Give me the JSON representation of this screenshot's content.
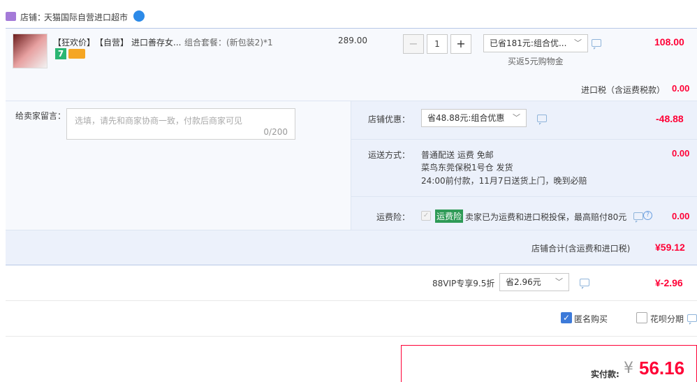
{
  "shop": {
    "label": "店铺：",
    "name": "天猫国际自营进口超市",
    "wangwang_icon": "wangwang-chat-icon"
  },
  "item": {
    "tag1": "【狂欢价】",
    "tag2": "【自营】",
    "title": "进口善存女...",
    "combo": "组合套餐：(新包装2)*1",
    "unit_price": "289.00",
    "quantity": "1",
    "minus_label": "−",
    "plus_label": "+",
    "promo_select": "已省181元:组合优...",
    "rebate": "买返5元购物金",
    "subtotal": "108.00",
    "badge_7": "7",
    "import_tax_label": "进口税（含运费税款）",
    "import_tax_value": "0.00"
  },
  "message": {
    "label": "给卖家留言：",
    "placeholder": "选填，请先和商家协商一致，付款后商家可见",
    "counter": "0/200"
  },
  "shop_discount": {
    "label": "店铺优惠：",
    "select": "省48.88元:组合优惠",
    "value": "-48.88"
  },
  "shipping": {
    "label": "运送方式：",
    "line1": "普通配送 运费 免邮",
    "line2": "菜鸟东莞保税1号仓  发货",
    "line3": "24:00前付款，11月7日送货上门，晚到必赔",
    "value": "0.00"
  },
  "insurance": {
    "label": "运费险：",
    "badge": "运费险",
    "text": "卖家已为运费和进口税投保，最高赔付80元",
    "value": "0.00"
  },
  "shop_total": {
    "label": "店铺合计(含运费和进口税)",
    "value": "¥59.12"
  },
  "vip": {
    "label": "88VIP专享9.5折",
    "select": "省2.96元",
    "value": "¥-2.96"
  },
  "options": {
    "anonymous": "匿名购买",
    "huabei": "花呗分期"
  },
  "pay": {
    "label": "实付款:",
    "currency": "¥",
    "amount": "56.16"
  },
  "colors": {
    "accent_red": "#ff0036",
    "panel_blue": "#ecf1fb",
    "checkbox_blue": "#3d7ad9",
    "badge_green": "#2e9a56"
  }
}
